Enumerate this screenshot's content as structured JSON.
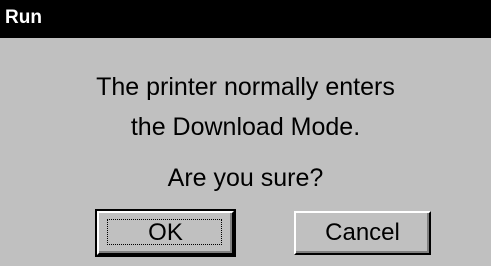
{
  "window": {
    "title": "Run"
  },
  "message": {
    "line1": "The printer normally enters",
    "line2": "the Download Mode.",
    "question": "Are you sure?"
  },
  "buttons": {
    "ok_label": "OK",
    "cancel_label": "Cancel"
  },
  "colors": {
    "titlebar": "#000000",
    "dialog_face": "#c0c0c0",
    "text": "#000000"
  }
}
